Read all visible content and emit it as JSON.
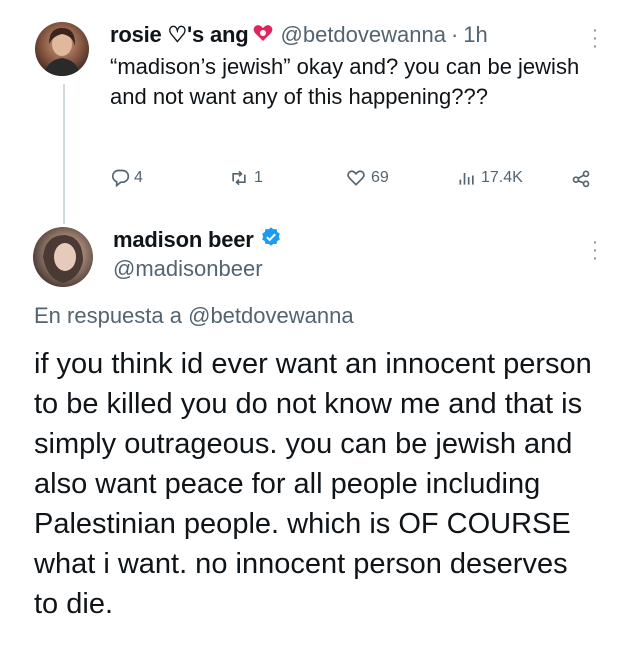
{
  "parent_tweet": {
    "display_name": "rosie ♡'s ang",
    "handle": "@betdovewanna",
    "separator": "·",
    "time": "1h",
    "text": "“madison’s jewish” okay and? you can be jewish and not want any of this happening???",
    "actions": {
      "replies": "4",
      "retweets": "1",
      "likes": "69",
      "views": "17.4K"
    }
  },
  "reply_tweet": {
    "display_name": "madison beer",
    "handle": "@madisonbeer",
    "verified": true,
    "replying_to_prefix": "En respuesta a",
    "replying_to_handle": "@betdovewanna",
    "text": "if you think id ever want an innocent person to be killed you do not know me and that is simply outrageous. you can be jewish and also want peace for all people including Palestinian people. which is OF COURSE what i want. no innocent person deserves to die."
  },
  "colors": {
    "text": "#0f1419",
    "secondary": "#536471",
    "verified_blue": "#1d9bf0",
    "heart_red": "#f91880"
  }
}
